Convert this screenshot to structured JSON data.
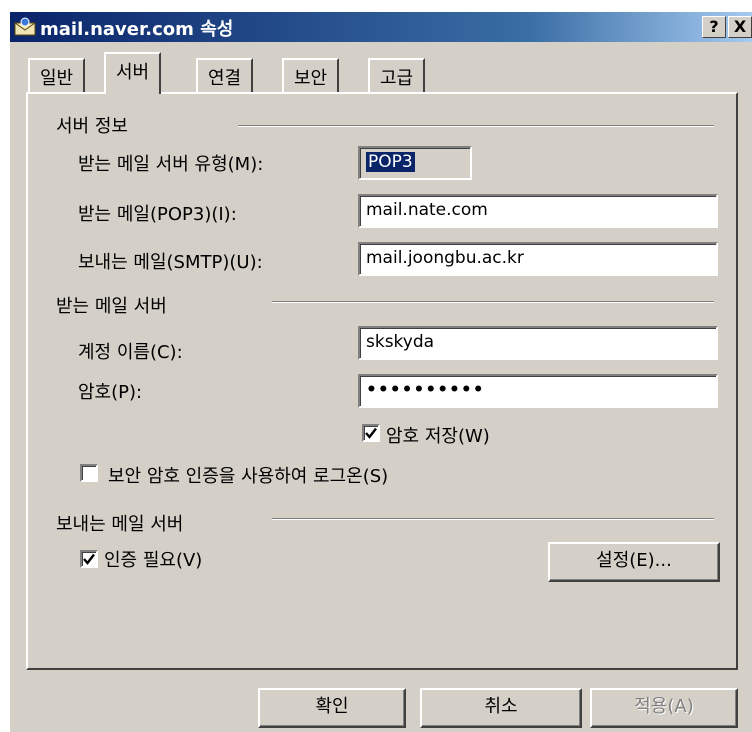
{
  "window": {
    "title": "mail.naver.com 속성",
    "help_glyph": "?",
    "close_glyph": "X"
  },
  "tabs": [
    {
      "label": "일반"
    },
    {
      "label": "서버"
    },
    {
      "label": "연결"
    },
    {
      "label": "보안"
    },
    {
      "label": "고급"
    }
  ],
  "active_tab": "서버",
  "server_info": {
    "group_title": "서버 정보",
    "incoming_type_label": "받는 메일 서버 유형(M):",
    "incoming_type_value": "POP3",
    "incoming_label": "받는 메일(POP3)(I):",
    "incoming_value": "mail.nate.com",
    "outgoing_label": "보내는 메일(SMTP)(U):",
    "outgoing_value": "mail.joongbu.ac.kr"
  },
  "incoming_server": {
    "group_title": "받는 메일 서버",
    "account_label": "계정 이름(C):",
    "account_value": "skskyda",
    "password_label": "암호(P):",
    "password_value": "••••••••••",
    "remember_label": "암호 저장(W)",
    "remember_checked": true,
    "spa_label": "보안 암호 인증을 사용하여 로그온(S)",
    "spa_checked": false
  },
  "outgoing_server": {
    "group_title": "보내는 메일 서버",
    "auth_label": "인증 필요(V)",
    "auth_checked": true,
    "settings_button": "설정(E)..."
  },
  "footer": {
    "ok": "확인",
    "cancel": "취소",
    "apply": "적용(A)"
  }
}
